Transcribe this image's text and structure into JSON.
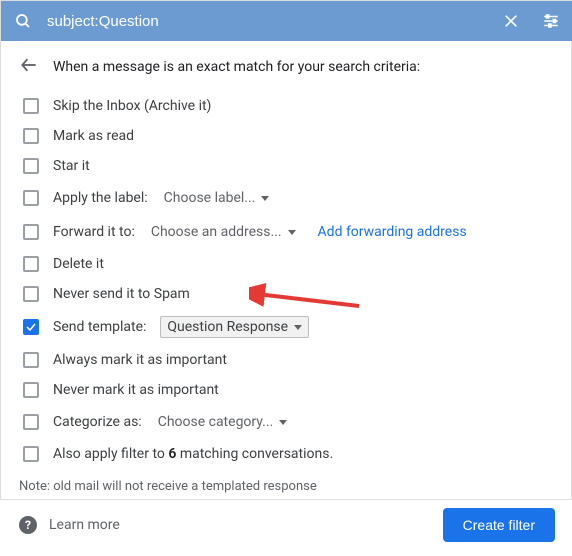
{
  "search": {
    "query": "subject:Question"
  },
  "header": {
    "title": "When a message is an exact match for your search criteria:"
  },
  "options": {
    "skip_inbox": "Skip the Inbox (Archive it)",
    "mark_read": "Mark as read",
    "star": "Star it",
    "apply_label_prefix": "Apply the label:",
    "apply_label_value": "Choose label...",
    "forward_prefix": "Forward it to:",
    "forward_value": "Choose an address...",
    "forward_link": "Add forwarding address",
    "delete": "Delete it",
    "never_spam": "Never send it to Spam",
    "send_template_prefix": "Send template:",
    "send_template_value": "Question Response",
    "always_important": "Always mark it as important",
    "never_important": "Never mark it as important",
    "categorize_prefix": "Categorize as:",
    "categorize_value": "Choose category...",
    "also_apply_prefix": "Also apply filter to ",
    "also_apply_count": "6",
    "also_apply_suffix": " matching conversations."
  },
  "note": "Note: old mail will not receive a templated response",
  "footer": {
    "learn_more": "Learn more",
    "create": "Create filter"
  }
}
